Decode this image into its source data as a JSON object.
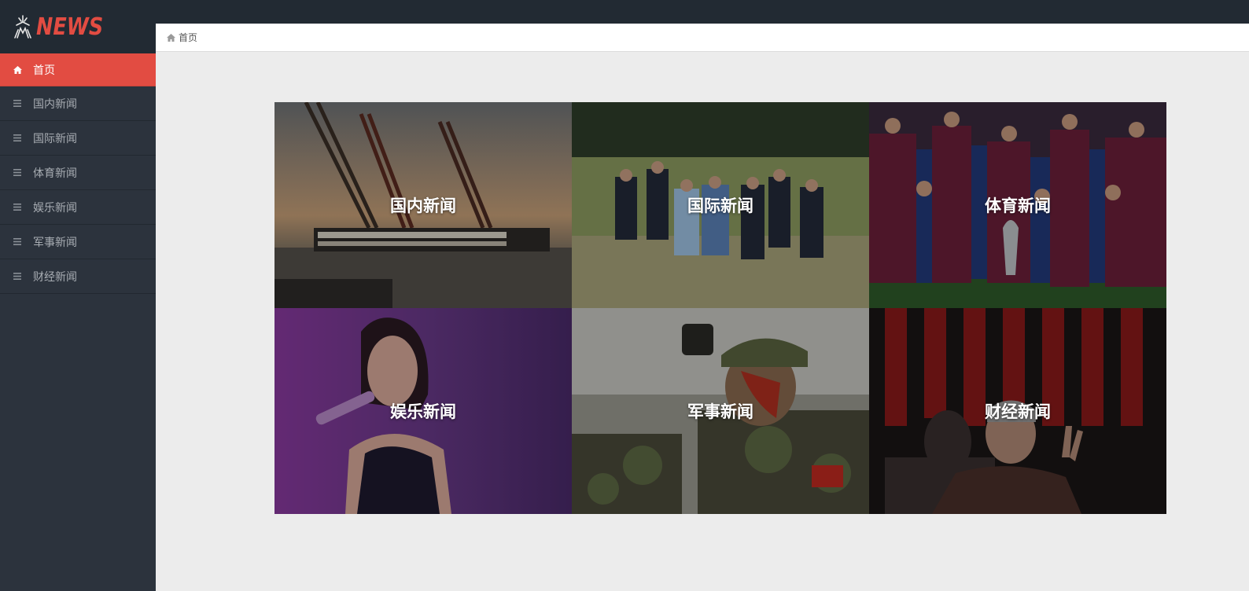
{
  "brand": {
    "logo_text": "NEWS",
    "accent": "#e24c42"
  },
  "sidebar": {
    "items": [
      {
        "label": "首页",
        "icon": "home-icon",
        "active": true
      },
      {
        "label": "国内新闻",
        "icon": "list-icon"
      },
      {
        "label": "国际新闻",
        "icon": "list-icon"
      },
      {
        "label": "体育新闻",
        "icon": "list-icon"
      },
      {
        "label": "娱乐新闻",
        "icon": "list-icon"
      },
      {
        "label": "军事新闻",
        "icon": "list-icon"
      },
      {
        "label": "财经新闻",
        "icon": "list-icon"
      }
    ]
  },
  "breadcrumb": {
    "label": "首页",
    "icon": "home-icon"
  },
  "tiles": [
    {
      "label": "国内新闻"
    },
    {
      "label": "国际新闻"
    },
    {
      "label": "体育新闻"
    },
    {
      "label": "娱乐新闻"
    },
    {
      "label": "军事新闻"
    },
    {
      "label": "财经新闻"
    }
  ]
}
